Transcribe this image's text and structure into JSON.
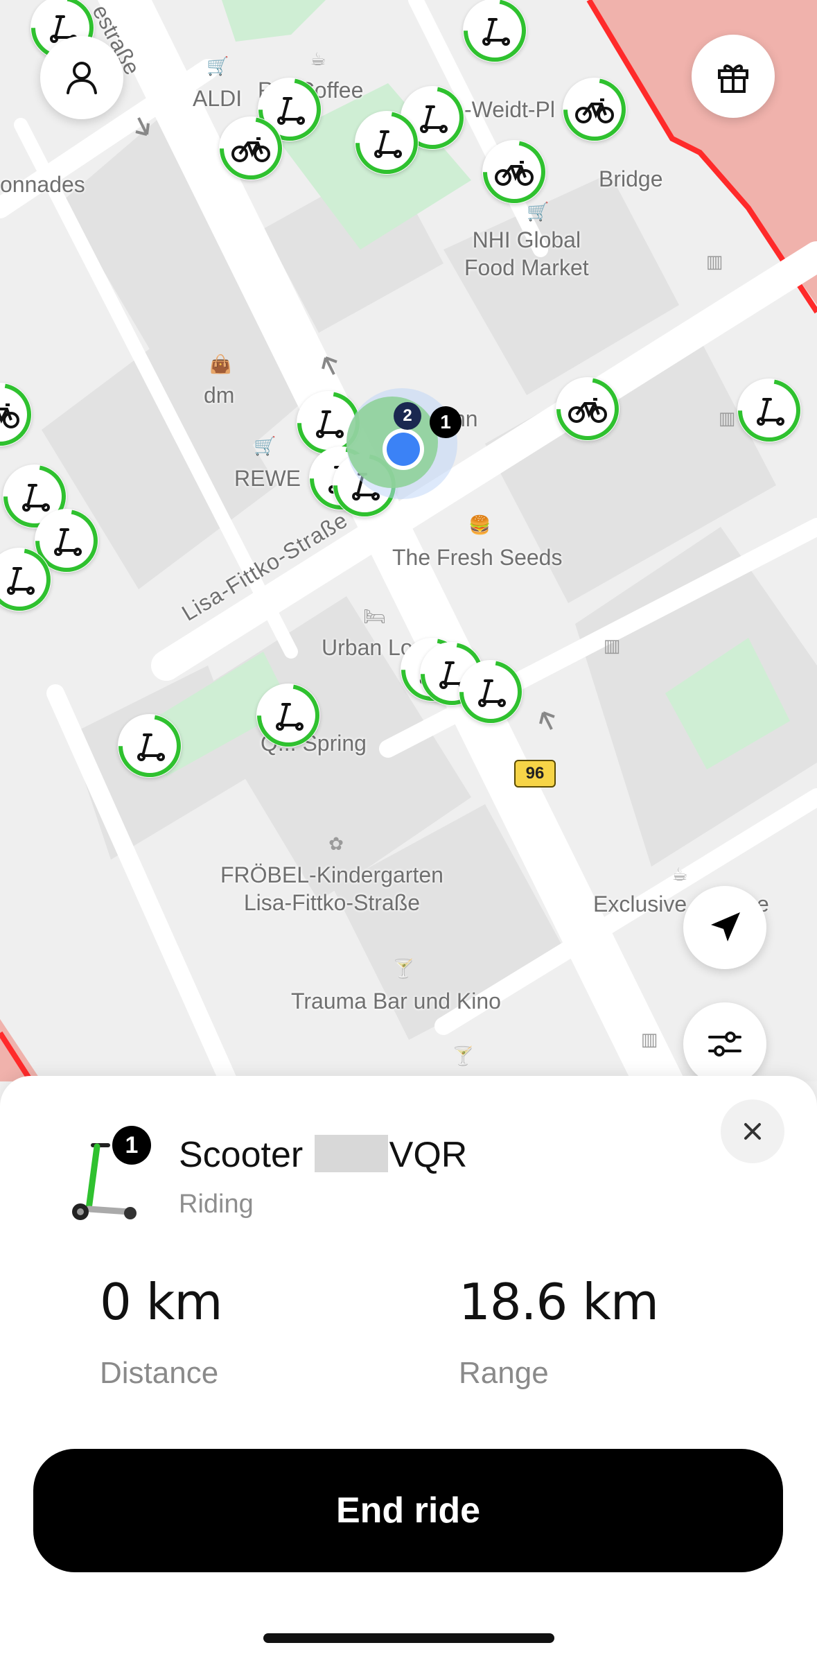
{
  "map": {
    "street_labels": [
      "Lisa-Fittko-Straße",
      "estraße"
    ],
    "place_labels": {
      "aldi": "ALDI",
      "coffee": "R... Coffee",
      "weidt": "-Weidt-Pl",
      "colonnades": "onnades",
      "bridge": "Bridge",
      "nhi": "NHI Global\nFood Market",
      "dm": "dm",
      "rewe": "REWE",
      "bahn": "hn",
      "fresh_seeds": "The Fresh Seeds",
      "urban_loft": "Urban Lo",
      "spring": "Q... Spring",
      "froebel": "FRÖBEL-Kindergarten\nLisa-Fittko-Straße",
      "exclusive": "Exclusive",
      "exclusive_tail": "e",
      "trauma": "Trauma Bar und Kino"
    },
    "route_number": "96",
    "cluster_badge": "1",
    "cluster_badge_2": "2",
    "colors": {
      "accent": "#2fc12f",
      "restricted": "#e53935",
      "user_dot": "#3b82f6"
    }
  },
  "controls": {
    "profile_icon": "person-icon",
    "gift_icon": "gift-icon",
    "locate_icon": "navigation-arrow-icon",
    "filter_icon": "sliders-icon"
  },
  "ride": {
    "vehicle_type": "Scooter",
    "vehicle_code": "VQR",
    "vehicle_badge": "1",
    "status": "Riding",
    "distance_value": "0 km",
    "distance_label": "Distance",
    "range_value": "18.6 km",
    "range_label": "Range",
    "end_button": "End ride"
  }
}
